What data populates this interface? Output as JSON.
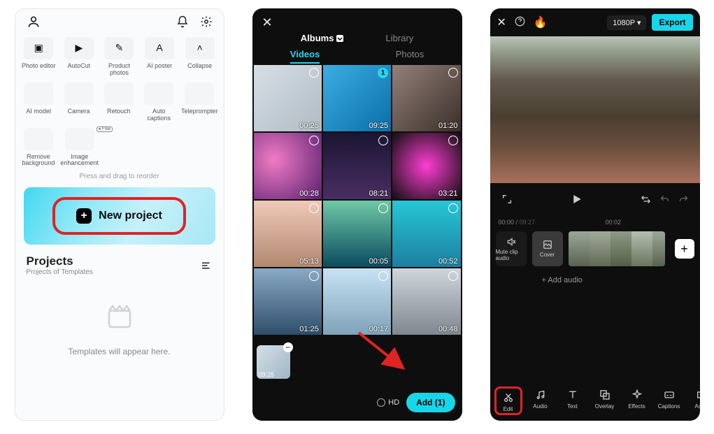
{
  "panel1": {
    "tools_row1": [
      {
        "label": "Photo editor"
      },
      {
        "label": "AutoCut"
      },
      {
        "label": "Product photos"
      },
      {
        "label": "AI poster"
      },
      {
        "label": "Collapse"
      }
    ],
    "tools_row2": [
      {
        "label": "AI model"
      },
      {
        "label": "Camera"
      },
      {
        "label": "Retouch"
      },
      {
        "label": "Auto captions"
      },
      {
        "label": "Teleprompter"
      }
    ],
    "tools_row3": [
      {
        "label": "Remove background"
      },
      {
        "label": "Image enhancement",
        "tag": "Free"
      }
    ],
    "reorder_hint": "Press and drag to reorder",
    "new_project_label": "New project",
    "projects_title": "Projects",
    "projects_sub": "Projects of Templates",
    "templates_empty": "Templates will appear here."
  },
  "panel2": {
    "top_tabs": {
      "albums": "Albums",
      "library": "Library"
    },
    "sub_tabs": {
      "videos": "Videos",
      "photos": "Photos"
    },
    "thumbs": [
      {
        "dur": "00:25",
        "cls": "noise-a",
        "selected": false
      },
      {
        "dur": "09:25",
        "cls": "noise-b",
        "selected": true,
        "badge": "1"
      },
      {
        "dur": "01:20",
        "cls": "noise-c",
        "selected": false
      },
      {
        "dur": "00:28",
        "cls": "noise-d",
        "selected": false
      },
      {
        "dur": "08:21",
        "cls": "noise-e",
        "selected": false
      },
      {
        "dur": "03:21",
        "cls": "noise-f",
        "selected": false
      },
      {
        "dur": "05:13",
        "cls": "noise-g",
        "selected": false
      },
      {
        "dur": "00:05",
        "cls": "noise-h",
        "selected": false
      },
      {
        "dur": "00:52",
        "cls": "noise-i",
        "selected": false
      },
      {
        "dur": "01:25",
        "cls": "noise-j",
        "selected": false
      },
      {
        "dur": "00:17",
        "cls": "noise-k",
        "selected": false
      },
      {
        "dur": "00:48",
        "cls": "noise-l",
        "selected": false
      }
    ],
    "selected_dur": "09:25",
    "hd_label": "HD",
    "add_label": "Add (1)"
  },
  "panel3": {
    "resolution": "1080P",
    "export_label": "Export",
    "time_current": "00:00",
    "time_total": "09:27",
    "time_mark": "00:02",
    "mute_label": "Mute clip audio",
    "cover_label": "Cover",
    "add_audio_label": "+ Add audio",
    "tools": [
      {
        "label": "Edit",
        "highlight": true
      },
      {
        "label": "Audio"
      },
      {
        "label": "Text"
      },
      {
        "label": "Overlay"
      },
      {
        "label": "Effects"
      },
      {
        "label": "Captions"
      },
      {
        "label": "Aspe"
      }
    ]
  }
}
